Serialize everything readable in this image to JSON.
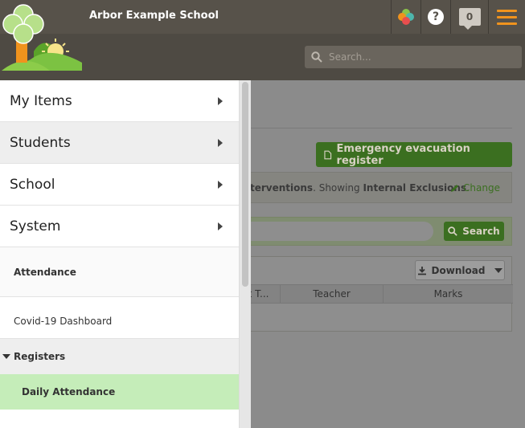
{
  "header": {
    "school_name": "Arbor Example School",
    "notification_count": "0",
    "help_label": "?",
    "search_placeholder": "Search...",
    "accent_color": "#f0931d"
  },
  "background_page": {
    "emergency_button": "Emergency evacuation register",
    "info": {
      "fragment": "terventions",
      "showing_prefix": ". Showing ",
      "showing_value": "Internal Exclusions",
      "suffix": ".",
      "change_label": "Change"
    },
    "search_button": "Search",
    "download_button": "Download",
    "table_columns": [
      "nt T...",
      "Teacher",
      "Marks"
    ]
  },
  "menu": {
    "main_items": [
      {
        "label": "My Items",
        "active": false
      },
      {
        "label": "Students",
        "active": true
      },
      {
        "label": "School",
        "active": false
      },
      {
        "label": "System",
        "active": false
      }
    ],
    "section_title": "Attendance",
    "sub_items": [
      "Covid-19 Dashboard"
    ],
    "group_title": "Registers",
    "active_leaf": "Daily Attendance",
    "active_color": "#c5edb9"
  }
}
